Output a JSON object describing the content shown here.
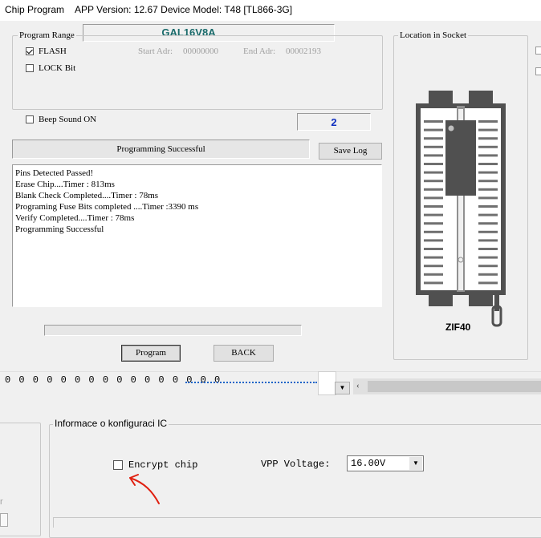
{
  "window": {
    "title": "Chip Program",
    "app_info": "APP Version: 12.67 Device Model: T48 [TL866-3G]"
  },
  "chip_name": "GAL16V8A",
  "program_range": {
    "label": "Program Range",
    "flash_label": "FLASH",
    "flash_checked": true,
    "lock_label": "LOCK Bit",
    "lock_checked": false,
    "start_label": "Start Adr:",
    "start_value": "00000000",
    "end_label": "End Adr:",
    "end_value": "00002193"
  },
  "beep": {
    "label": "Beep Sound ON",
    "checked": false
  },
  "counter": "2",
  "status_text": "Programming Successful",
  "save_log_label": "Save Log",
  "log_lines": [
    "Pins Detected Passed!",
    "Erase Chip....Timer : 813ms",
    "Blank Check Completed....Timer : 78ms",
    "Programing Fuse Bits completed ....Timer :3390 ms",
    "Verify Completed....Timer : 78ms",
    "Programming Successful"
  ],
  "progress": 0,
  "program_label": "Program",
  "back_label": "BACK",
  "socket": {
    "label": "Location in Socket",
    "type": "ZIF40"
  },
  "hex_row": "0 0 0 0 0 0 0 0 0 0 0 0 0 0 0 0",
  "config": {
    "label": "Informace o konfiguraci IC",
    "encrypt_label": "Encrypt chip",
    "encrypt_checked": false,
    "vpp_label": "VPP Voltage:",
    "vpp_value": "16.00V"
  },
  "colors": {
    "chip_name": "#1a6b6b",
    "counter": "#1030c0",
    "annotation_arrow": "#e02010",
    "dotted_line": "#1b64c8"
  }
}
